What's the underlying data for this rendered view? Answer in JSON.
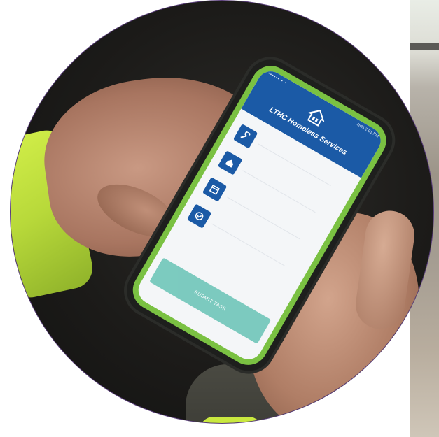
{
  "app": {
    "title": "LTHC Homeless Services",
    "status_left": "▪▪▪▪▪▪ ▪ ▪",
    "status_right": "46% 2:01 PM",
    "submit_label": "SUBMIT TASK"
  },
  "icons": [
    "wrench-icon",
    "home-icon",
    "calendar-icon",
    "check-circle-icon"
  ],
  "colors": {
    "header": "#1b5aa6",
    "submit": "#6fc6b8",
    "case_bumper": "#7ac142",
    "jacket": "#c9e83f"
  }
}
